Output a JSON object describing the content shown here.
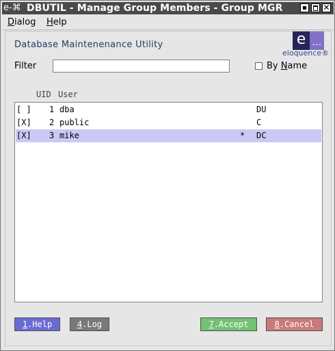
{
  "window": {
    "icon_glyph": "e-⌘",
    "title": "DBUTIL - Manage Group Members - Group MGR"
  },
  "menubar": {
    "items": [
      {
        "label": "Dialog",
        "mnemonic": "D",
        "rest": "ialog"
      },
      {
        "label": "Help",
        "mnemonic": "H",
        "rest": "elp"
      }
    ]
  },
  "header": {
    "heading": "Database Maintenenance Utility",
    "logo": {
      "letter": "e",
      "dots": "...",
      "text": "eloquence®"
    }
  },
  "filter": {
    "label": "Filter",
    "value": "",
    "by_name_checked": false,
    "by_name_prefix": "By ",
    "by_name_mnemonic": "N",
    "by_name_rest": "ame"
  },
  "list": {
    "columns": {
      "uid": "UID",
      "user": "User"
    },
    "rows": [
      {
        "mark": "[ ]",
        "uid": "1",
        "user": "dba",
        "flag": "",
        "access": "DU",
        "selected": false
      },
      {
        "mark": "[X]",
        "uid": "2",
        "user": "public",
        "flag": "",
        "access": "C",
        "selected": false
      },
      {
        "mark": "[X]",
        "uid": "3",
        "user": "mike",
        "flag": "*",
        "access": "DC",
        "selected": true
      }
    ]
  },
  "buttons": {
    "help": {
      "key": "1",
      "label": ".Help"
    },
    "log": {
      "key": "4",
      "label": ".Log"
    },
    "accept": {
      "key": "7",
      "label": ".Accept"
    },
    "cancel": {
      "key": "8",
      "label": ".Cancel"
    }
  },
  "colors": {
    "title_bar": "#4a4a4a",
    "selection": "#c9c9f4",
    "help_button": "#6b6bd6",
    "log_button": "#7a7a7a",
    "accept_button": "#74c074",
    "cancel_button": "#c97a7a"
  }
}
